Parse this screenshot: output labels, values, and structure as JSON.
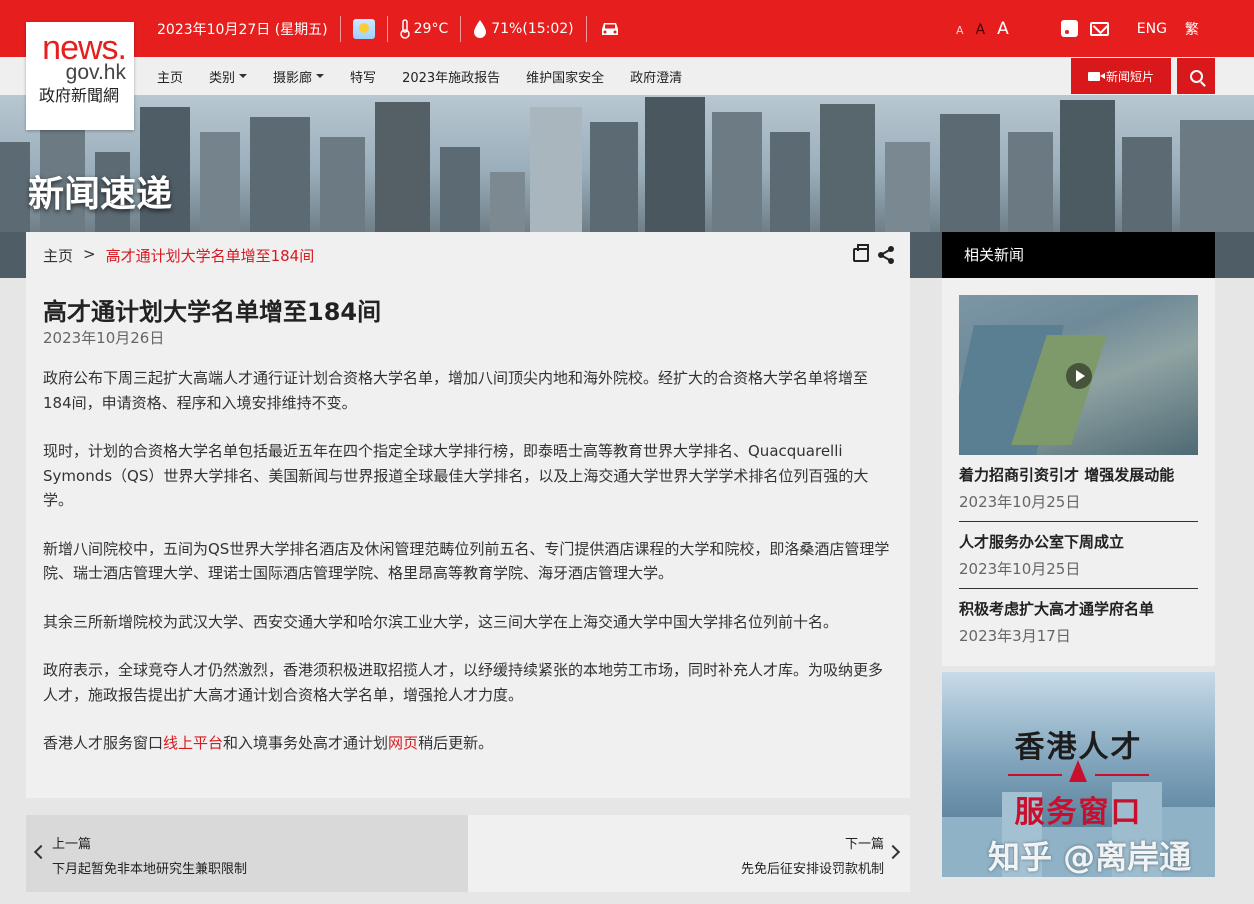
{
  "topbar": {
    "date": "2023年10月27日 (星期五)",
    "temperature": "29°C",
    "humidity": "71%(15:02)",
    "weather_icon": "sunny-cloudy-icon",
    "font_small": "A",
    "font_medium": "A",
    "font_large": "A",
    "lang_eng": "ENG",
    "lang_trad": "繁"
  },
  "logo": {
    "line1": "news.",
    "line2": "gov.hk",
    "line3": "政府新聞網"
  },
  "nav": {
    "items": [
      "主页",
      "类别",
      "摄影廊",
      "特写",
      "2023年施政报告",
      "维护国家安全",
      "政府澄清"
    ],
    "short_video": "新闻短片"
  },
  "banner": {
    "title": "新闻速递"
  },
  "breadcrumb": {
    "home": "主页",
    "separator": ">",
    "current": "高才通计划大学名单增至184间"
  },
  "article": {
    "title": "高才通计划大学名单增至184间",
    "date": "2023年10月26日",
    "p1": "政府公布下周三起扩大高端人才通行证计划合资格大学名单，增加八间顶尖内地和海外院校。经扩大的合资格大学名单将增至184间，申请资格、程序和入境安排维持不变。",
    "p2": "现时，计划的合资格大学名单包括最近五年在四个指定全球大学排行榜，即泰晤士高等教育世界大学排名、Quacquarelli Symonds（QS）世界大学排名、美国新闻与世界报道全球最佳大学排名，以及上海交通大学世界大学学术排名位列百强的大学。",
    "p3": "新增八间院校中，五间为QS世界大学排名酒店及休闲管理范畴位列前五名、专门提供酒店课程的大学和院校，即洛桑酒店管理学院、瑞士酒店管理大学、理诺士国际酒店管理学院、格里昂高等教育学院、海牙酒店管理大学。",
    "p4": "其余三所新增院校为武汉大学、西安交通大学和哈尔滨工业大学，这三间大学在上海交通大学中国大学排名位列前十名。",
    "p5": "政府表示，全球竞夺人才仍然激烈，香港须积极进取招揽人才，以纾缓持续紧张的本地劳工市场，同时补充人才库。为吸纳更多人才，施政报告提出扩大高才通计划合资格大学名单，增强抢人才力度。",
    "p6_a": "香港人才服务窗口",
    "p6_link1": "线上平台",
    "p6_b": "和入境事务处高才通计划",
    "p6_link2": "网页",
    "p6_c": "稍后更新。"
  },
  "pager": {
    "prev_label": "上一篇",
    "prev_title": "下月起暂免非本地研究生兼职限制",
    "next_label": "下一篇",
    "next_title": "先免后征安排设罚款机制"
  },
  "sidebar": {
    "heading": "相关新闻",
    "items": [
      {
        "title": "着力招商引资引才 增强发展动能",
        "date": "2023年10月25日"
      },
      {
        "title": "人才服务办公室下周成立",
        "date": "2023年10月25日"
      },
      {
        "title": "积极考虑扩大高才通学府名单",
        "date": "2023年3月17日"
      }
    ]
  },
  "ad": {
    "line1": "香港人才",
    "line2": "服务窗口"
  },
  "watermark": "知乎 @离岸通"
}
